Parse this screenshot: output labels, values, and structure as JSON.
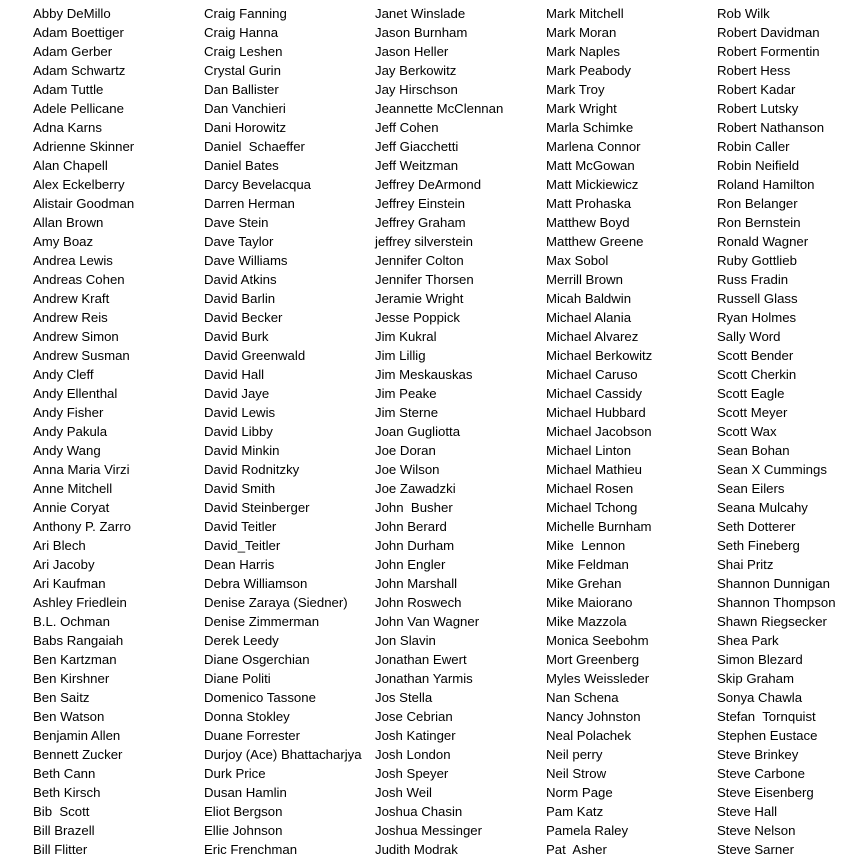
{
  "columns": [
    [
      "Abby DeMillo",
      "Adam Boettiger",
      "Adam Gerber",
      "Adam Schwartz",
      "Adam Tuttle",
      "Adele Pellicane",
      "Adna Karns",
      "Adrienne Skinner",
      "Alan Chapell",
      "Alex Eckelberry",
      "Alistair Goodman",
      "Allan Brown",
      "Amy Boaz",
      "Andrea Lewis",
      "Andreas Cohen",
      "Andrew Kraft",
      "Andrew Reis",
      "Andrew Simon",
      "Andrew Susman",
      "Andy Cleff",
      "Andy Ellenthal",
      "Andy Fisher",
      "Andy Pakula",
      "Andy Wang",
      "Anna Maria Virzi",
      "Anne Mitchell",
      "Annie Coryat",
      "Anthony P. Zarro",
      "Ari Blech",
      "Ari Jacoby",
      "Ari Kaufman",
      "Ashley Friedlein",
      "B.L. Ochman",
      "Babs Rangaiah",
      "Ben Kartzman",
      "Ben Kirshner",
      "Ben Saitz",
      "Ben Watson",
      "Benjamin Allen",
      "Bennett Zucker",
      "Beth Cann",
      "Beth Kirsch",
      "Bib  Scott",
      "Bill Brazell",
      "Bill Flitter"
    ],
    [
      "Craig Fanning",
      "Craig Hanna",
      "Craig Leshen",
      "Crystal Gurin",
      "Dan Ballister",
      "Dan Vanchieri",
      "Dani Horowitz",
      "Daniel  Schaeffer",
      "Daniel Bates",
      "Darcy Bevelacqua",
      "Darren Herman",
      "Dave Stein",
      "Dave Taylor",
      "Dave Williams",
      "David Atkins",
      "David Barlin",
      "David Becker",
      "David Burk",
      "David Greenwald",
      "David Hall",
      "David Jaye",
      "David Lewis",
      "David Libby",
      "David Minkin",
      "David Rodnitzky",
      "David Smith",
      "David Steinberger",
      "David Teitler",
      "David_Teitler",
      "Dean Harris",
      "Debra Williamson",
      "Denise Zaraya (Siedner)",
      "Denise Zimmerman",
      "Derek Leedy",
      "Diane Osgerchian",
      "Diane Politi",
      "Domenico Tassone",
      "Donna Stokley",
      "Duane Forrester",
      "Durjoy (Ace) Bhattacharjya",
      "Durk Price",
      "Dusan Hamlin",
      "Eliot Bergson",
      "Ellie Johnson",
      "Eric Frenchman"
    ],
    [
      "Janet Winslade",
      "Jason Burnham",
      "Jason Heller",
      "Jay Berkowitz",
      "Jay Hirschson",
      "Jeannette McClennan",
      "Jeff Cohen",
      "Jeff Giacchetti",
      "Jeff Weitzman",
      "Jeffrey DeArmond",
      "Jeffrey Einstein",
      "Jeffrey Graham",
      "jeffrey silverstein",
      "Jennifer Colton",
      "Jennifer Thorsen",
      "Jeramie Wright",
      "Jesse Poppick",
      "Jim Kukral",
      "Jim Lillig",
      "Jim Meskauskas",
      "Jim Peake",
      "Jim Sterne",
      "Joan Gugliotta",
      "Joe Doran",
      "Joe Wilson",
      "Joe Zawadzki",
      "John  Busher",
      "John Berard",
      "John Durham",
      "John Engler",
      "John Marshall",
      "John Roswech",
      "John Van Wagner",
      "Jon Slavin",
      "Jonathan Ewert",
      "Jonathan Yarmis",
      "Jos Stella",
      "Jose Cebrian",
      "Josh Katinger",
      "Josh London",
      "Josh Speyer",
      "Josh Weil",
      "Joshua Chasin",
      "Joshua Messinger",
      "Judith Modrak"
    ],
    [
      "Mark Mitchell",
      "Mark Moran",
      "Mark Naples",
      "Mark Peabody",
      "Mark Troy",
      "Mark Wright",
      "Marla Schimke",
      "Marlena Connor",
      "Matt McGowan",
      "Matt Mickiewicz",
      "Matt Prohaska",
      "Matthew Boyd",
      "Matthew Greene",
      "Max Sobol",
      "Merrill Brown",
      "Micah Baldwin",
      "Michael Alania",
      "Michael Alvarez",
      "Michael Berkowitz",
      "Michael Caruso",
      "Michael Cassidy",
      "Michael Hubbard",
      "Michael Jacobson",
      "Michael Linton",
      "Michael Mathieu",
      "Michael Rosen",
      "Michael Tchong",
      "Michelle Burnham",
      "Mike  Lennon",
      "Mike Feldman",
      "Mike Grehan",
      "Mike Maiorano",
      "Mike Mazzola",
      "Monica Seebohm",
      "Mort Greenberg",
      "Myles Weissleder",
      "Nan Schena",
      "Nancy Johnston",
      "Neal Polachek",
      "Neil perry",
      "Neil Strow",
      "Norm Page",
      "Pam Katz",
      "Pamela Raley",
      "Pat  Asher"
    ],
    [
      "Rob Wilk",
      "Robert Davidman",
      "Robert Formentin",
      "Robert Hess",
      "Robert Kadar",
      "Robert Lutsky",
      "Robert Nathanson",
      "Robin Caller",
      "Robin Neifield",
      "Roland Hamilton",
      "Ron Belanger",
      "Ron Bernstein",
      "Ronald Wagner",
      "Ruby Gottlieb",
      "Russ Fradin",
      "Russell Glass",
      "Ryan Holmes",
      "Sally Word",
      "Scott Bender",
      "Scott Cherkin",
      "Scott Eagle",
      "Scott Meyer",
      "Scott Wax",
      "Sean Bohan",
      "Sean X Cummings",
      "Sean Eilers",
      "Seana Mulcahy",
      "Seth Dotterer",
      "Seth Fineberg",
      "Shai Pritz",
      "Shannon Dunnigan",
      "Shannon Thompson",
      "Shawn Riegsecker",
      "Shea Park",
      "Simon Blezard",
      "Skip Graham",
      "Sonya Chawla",
      "Stefan  Tornquist",
      "Stephen Eustace",
      "Steve Brinkey",
      "Steve Carbone",
      "Steve Eisenberg",
      "Steve Hall",
      "Steve Nelson",
      "Steve Sarner"
    ]
  ]
}
